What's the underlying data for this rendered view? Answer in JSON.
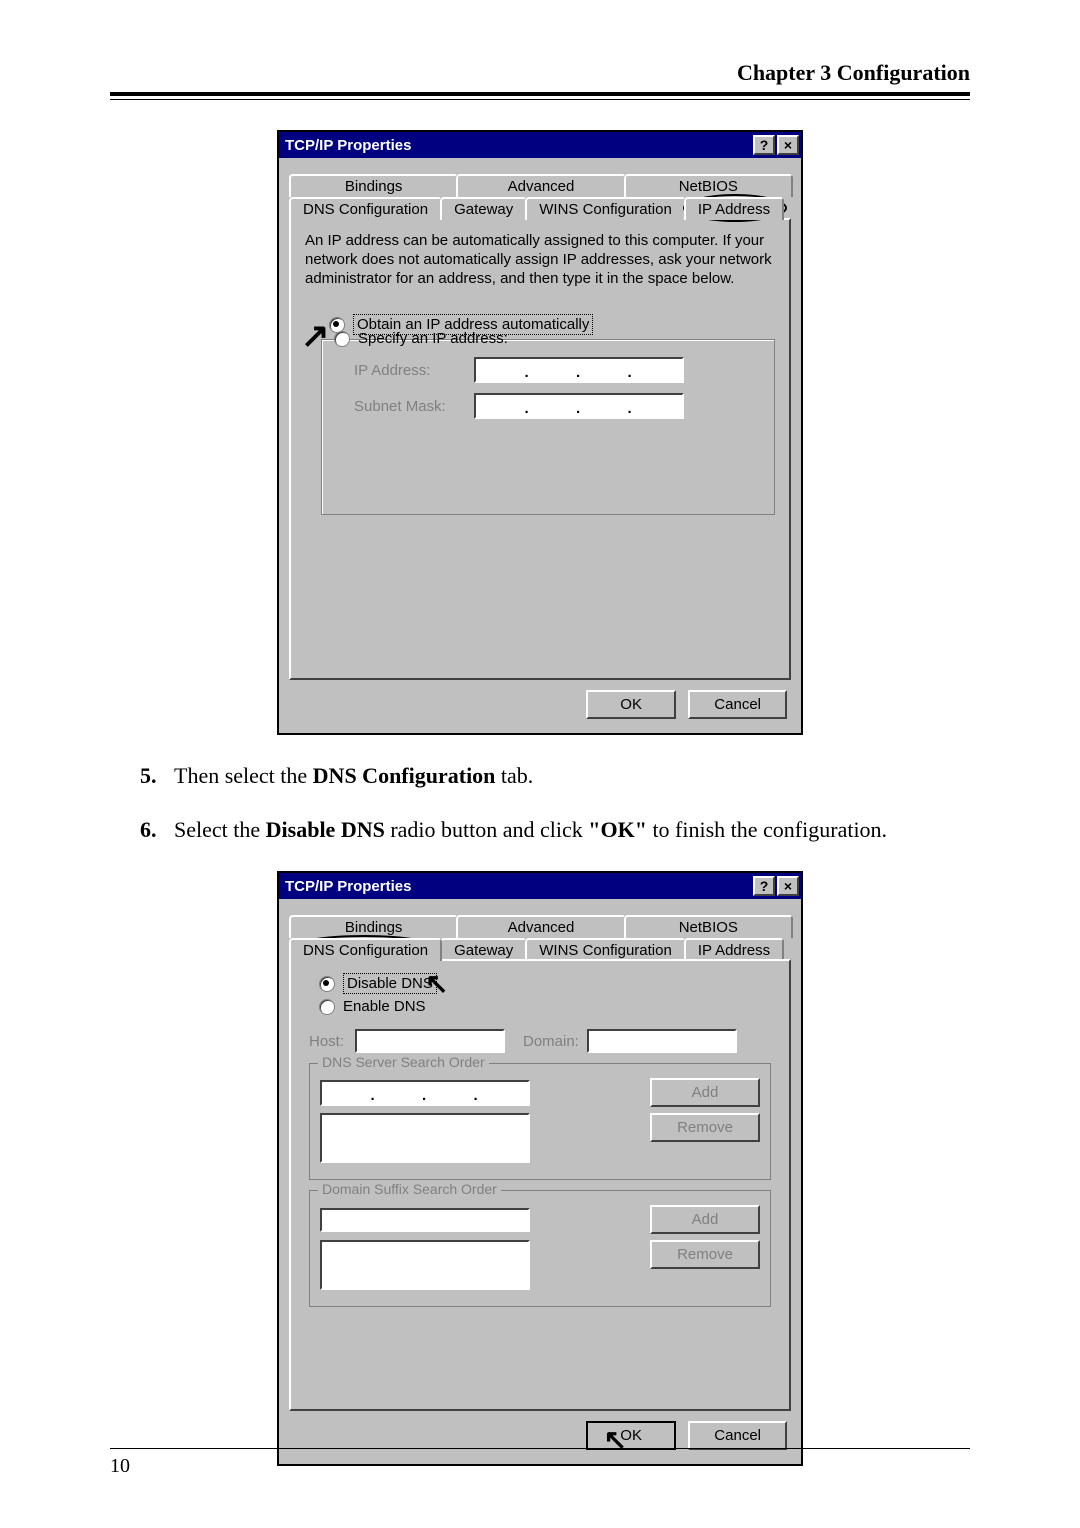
{
  "header": "Chapter 3 Configuration",
  "page_number": "10",
  "dialog1": {
    "title": "TCP/IP Properties",
    "help_btn": "?",
    "close_btn": "×",
    "tabs_row1": [
      "Bindings",
      "Advanced",
      "NetBIOS"
    ],
    "tabs_row2": [
      "DNS Configuration",
      "Gateway",
      "WINS Configuration",
      "IP Address"
    ],
    "description": "An IP address can be automatically assigned to this computer. If your network does not automatically assign IP addresses, ask your network administrator for an address, and then type it in the space below.",
    "radio_obtain": "Obtain an IP address automatically",
    "radio_specify": "Specify an IP address:",
    "ip_label": "IP Address:",
    "subnet_label": "Subnet Mask:",
    "ok": "OK",
    "cancel": "Cancel"
  },
  "step5_num": "5.",
  "step5_text_a": "Then select the ",
  "step5_text_b": "DNS Configuration",
  "step5_text_c": " tab.",
  "step6_num": "6.",
  "step6_text_a": "Select the ",
  "step6_text_b": "Disable DNS",
  "step6_text_c": " radio button and click ",
  "step6_text_d": "\"OK\"",
  "step6_text_e": " to finish the configuration.",
  "dialog2": {
    "title": "TCP/IP Properties",
    "help_btn": "?",
    "close_btn": "×",
    "tabs_row1": [
      "Bindings",
      "Advanced",
      "NetBIOS"
    ],
    "tabs_row2": [
      "DNS Configuration",
      "Gateway",
      "WINS Configuration",
      "IP Address"
    ],
    "radio_disable": "Disable DNS",
    "radio_enable": "Enable DNS",
    "host_label": "Host:",
    "domain_label": "Domain:",
    "dns_order_title": "DNS Server Search Order",
    "suffix_order_title": "Domain Suffix Search Order",
    "add": "Add",
    "remove": "Remove",
    "ok": "OK",
    "cancel": "Cancel"
  }
}
